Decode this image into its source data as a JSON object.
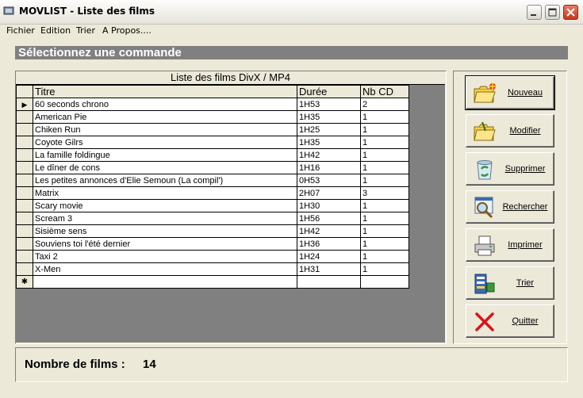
{
  "window": {
    "title": "MOVLIST - Liste des films",
    "minimize_icon": "minimize-icon",
    "maximize_icon": "maximize-icon",
    "close_icon": "close-icon",
    "close_color": "#D44A2E"
  },
  "menu": [
    {
      "label": "Fichier",
      "accel": "F"
    },
    {
      "label": "Edition",
      "accel": "E"
    },
    {
      "label": "Trier",
      "accel": "T"
    },
    {
      "label": "A Propos....",
      "accel": ""
    }
  ],
  "header": {
    "text": "Sélectionnez une commande",
    "bg": "#808080"
  },
  "grid": {
    "caption": "Liste des films DivX / MP4",
    "columns": [
      "Titre",
      "Durée",
      "Nb CD"
    ],
    "rows": [
      [
        "60 seconds chrono",
        "1H53",
        "2"
      ],
      [
        "American Pie",
        "1H35",
        "1"
      ],
      [
        "Chiken Run",
        "1H25",
        "1"
      ],
      [
        "Coyote Gilrs",
        "1H35",
        "1"
      ],
      [
        "La famille foldingue",
        "1H42",
        "1"
      ],
      [
        "Le dîner de cons",
        "1H16",
        "1"
      ],
      [
        "Les petites annonces d'Elie Semoun (La compil')",
        "0H53",
        "1"
      ],
      [
        "Matrix",
        "2H07",
        "3"
      ],
      [
        "Scary movie",
        "1H30",
        "1"
      ],
      [
        "Scream 3",
        "1H56",
        "1"
      ],
      [
        "Sisième sens",
        "1H42",
        "1"
      ],
      [
        "Souviens toi l'été dernier",
        "1H36",
        "1"
      ],
      [
        "Taxi 2",
        "1H24",
        "1"
      ],
      [
        "X-Men",
        "1H31",
        "1"
      ]
    ],
    "current_row_marker": "▶",
    "new_row_marker": "✱"
  },
  "buttons": [
    {
      "label": "Nouveau",
      "icon": "new-folder-icon"
    },
    {
      "label": "Modifier",
      "icon": "edit-folder-icon"
    },
    {
      "label": "Supprimer",
      "icon": "recycle-bin-icon"
    },
    {
      "label": "Rechercher",
      "icon": "search-icon"
    },
    {
      "label": "Imprimer",
      "icon": "printer-icon"
    },
    {
      "label": "Trier",
      "icon": "sort-icon"
    },
    {
      "label": "Quitter",
      "icon": "exit-icon"
    }
  ],
  "footer": {
    "label": "Nombre de films :",
    "value": "14"
  }
}
